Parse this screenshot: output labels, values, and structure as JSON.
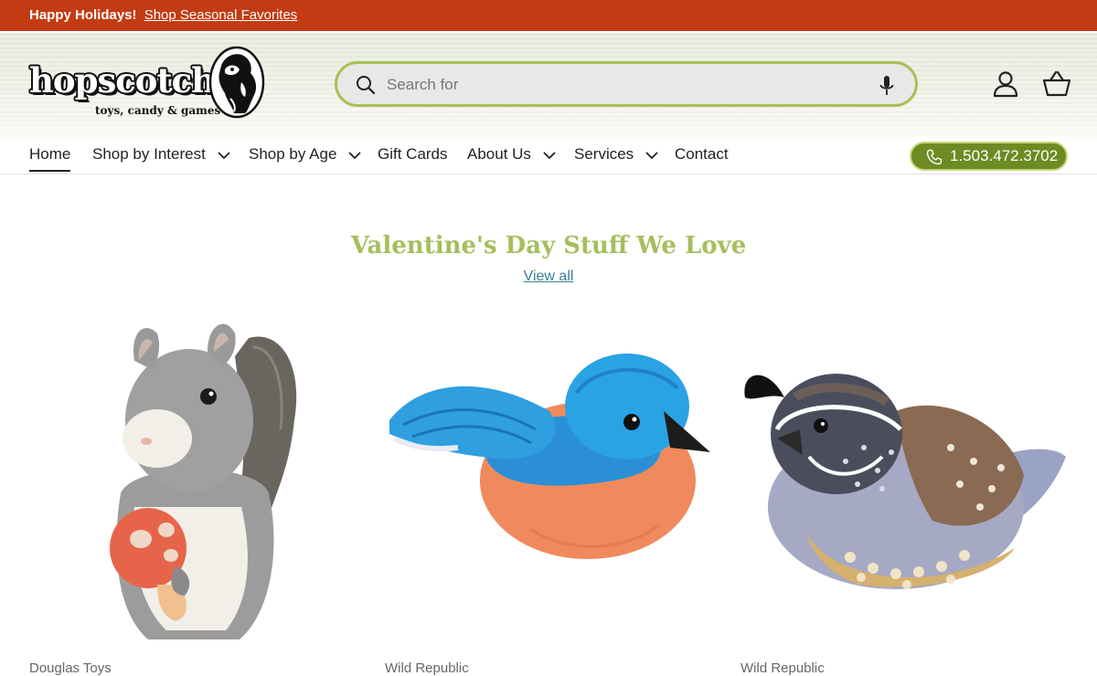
{
  "announcement": {
    "bold": "Happy Holidays!",
    "link": "Shop Seasonal Favorites"
  },
  "logo": {
    "wordmark": "hopscotch",
    "tagline": "toys, candy & games"
  },
  "search": {
    "placeholder": "Search for",
    "icon": "search-icon",
    "mic_icon": "microphone-icon"
  },
  "header_icons": [
    "account-icon",
    "cart-icon"
  ],
  "nav": {
    "items": [
      {
        "label": "Home",
        "active": true,
        "dropdown": false
      },
      {
        "label": "Shop by Interest",
        "dropdown": true
      },
      {
        "label": "Shop by Age",
        "dropdown": true
      },
      {
        "label": "Gift Cards",
        "dropdown": false
      },
      {
        "label": "About Us",
        "dropdown": true
      },
      {
        "label": "Services",
        "dropdown": true
      },
      {
        "label": "Contact",
        "dropdown": false
      }
    ],
    "phone": "1.503.472.3702"
  },
  "section": {
    "title": "Valentine's Day Stuff We Love",
    "view_all": "View all"
  },
  "products": [
    {
      "vendor": "Douglas Toys",
      "image": "plush-squirrel-with-mushroom"
    },
    {
      "vendor": "Wild Republic",
      "image": "plush-bluebird"
    },
    {
      "vendor": "Wild Republic",
      "image": "plush-quail"
    }
  ],
  "colors": {
    "announcement_bg": "#c23b13",
    "accent_green": "#a6be5c",
    "phone_bg": "#6d8b23",
    "link_blue": "#3b7f9a"
  }
}
